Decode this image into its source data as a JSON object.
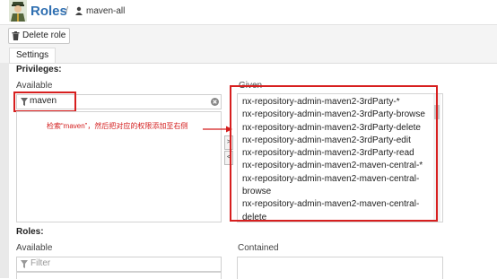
{
  "header": {
    "title": "Roles",
    "separator": "/",
    "breadcrumb": "maven-all"
  },
  "toolbar": {
    "delete_label": "Delete role"
  },
  "tabs": [
    {
      "label": "Settings"
    }
  ],
  "privileges": {
    "heading": "Privileges:",
    "available_label": "Available",
    "search_value": "maven",
    "given_label": "Given",
    "given_items": [
      "nx-repository-admin-maven2-3rdParty-*",
      "nx-repository-admin-maven2-3rdParty-browse",
      "nx-repository-admin-maven2-3rdParty-delete",
      "nx-repository-admin-maven2-3rdParty-edit",
      "nx-repository-admin-maven2-3rdParty-read",
      "nx-repository-admin-maven2-maven-central-*",
      "nx-repository-admin-maven2-maven-central-",
      "browse",
      "nx-repository-admin-maven2-maven-central-",
      "delete"
    ],
    "annotation": "检索“maven”，然后把对应的权限添加至右侧"
  },
  "roles": {
    "heading": "Roles:",
    "available_label": "Available",
    "filter_placeholder": "Filter",
    "contained_label": "Contained"
  },
  "colors": {
    "accent": "#2f6fb1",
    "highlight": "#d71f1f"
  }
}
